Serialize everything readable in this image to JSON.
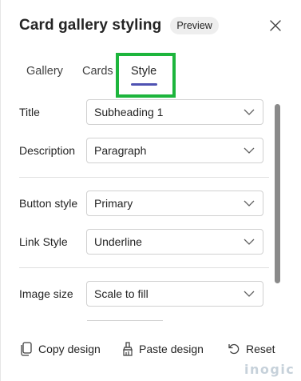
{
  "header": {
    "title": "Card gallery styling",
    "badge": "Preview"
  },
  "tabs": [
    {
      "label": "Gallery",
      "selected": false
    },
    {
      "label": "Cards",
      "selected": false
    },
    {
      "label": "Style",
      "selected": true
    }
  ],
  "form": {
    "rows": [
      {
        "label": "Title",
        "value": "Subheading 1"
      },
      {
        "label": "Description",
        "value": "Paragraph"
      },
      {
        "label": "Button style",
        "value": "Primary"
      },
      {
        "label": "Link Style",
        "value": "Underline"
      },
      {
        "label": "Image size",
        "value": "Scale to fill"
      }
    ]
  },
  "footer": {
    "copy_label": "Copy design",
    "paste_label": "Paste design",
    "reset_label": "Reset"
  },
  "watermark": "inogic",
  "colors": {
    "accent": "#4f52b2",
    "highlight": "#1db53c",
    "border": "#d1d1d1"
  }
}
